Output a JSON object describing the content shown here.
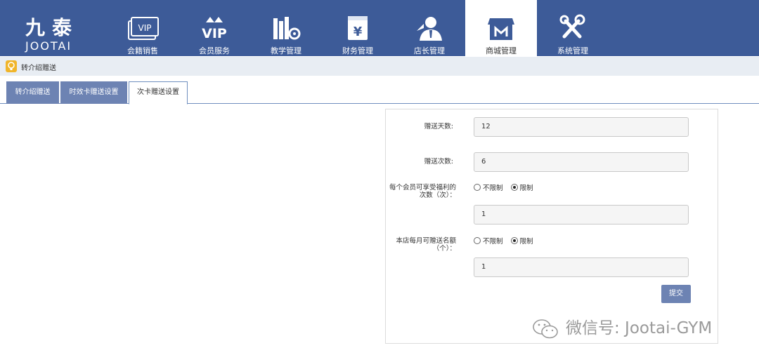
{
  "logo": {
    "cn": "九泰",
    "en": "JOOTAI"
  },
  "nav": [
    {
      "label": "会籍销售",
      "icon": "vip-card-icon"
    },
    {
      "label": "会员服务",
      "icon": "vip-crown-icon"
    },
    {
      "label": "教学管理",
      "icon": "books-gear-icon"
    },
    {
      "label": "财务管理",
      "icon": "yen-box-icon"
    },
    {
      "label": "店长管理",
      "icon": "manager-icon"
    },
    {
      "label": "商城管理",
      "icon": "shop-icon"
    },
    {
      "label": "系统管理",
      "icon": "tools-icon"
    }
  ],
  "breadcrumb": {
    "text": "转介绍赠送",
    "icon": "bulb-icon"
  },
  "tabs": [
    {
      "label": "转介绍赠送"
    },
    {
      "label": "时效卡赠送设置"
    },
    {
      "label": "次卡赠送设置"
    }
  ],
  "form": {
    "gift_days_label": "赠送天数:",
    "gift_days_value": "12",
    "gift_times_label": "赠送次数:",
    "gift_times_value": "6",
    "member_limit_label_line1": "每个会员可享受福利的",
    "member_limit_label_line2": "次数（次）：",
    "member_limit_unlimited": "不限制",
    "member_limit_limited": "限制",
    "member_limit_value": "1",
    "store_quota_label_line1": "本店每月可赠送名额",
    "store_quota_label_line2": "（个）：",
    "store_quota_unlimited": "不限制",
    "store_quota_limited": "限制",
    "store_quota_value": "1",
    "submit_label": "提交"
  },
  "watermark": {
    "text": "微信号: Jootai-GYM"
  },
  "colors": {
    "nav_bg": "#3d5b98",
    "tab_bg": "#6d83b3",
    "crumb_bg": "#e8edf3",
    "badge": "#f0b52a"
  }
}
